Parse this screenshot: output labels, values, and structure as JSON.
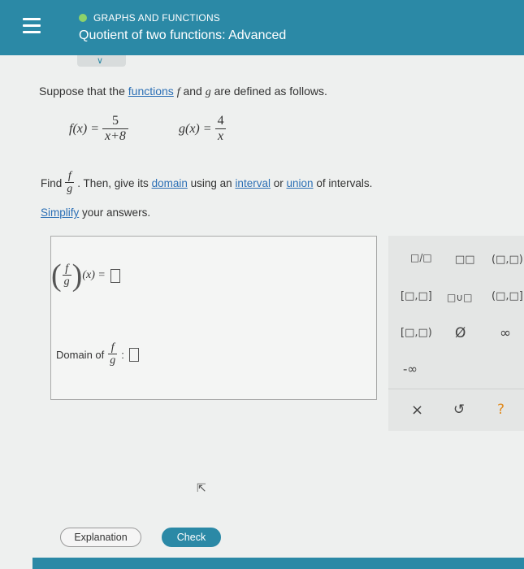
{
  "header": {
    "topic": "GRAPHS AND FUNCTIONS",
    "title": "Quotient of two functions: Advanced",
    "topic_dot_color": "#8dd36a",
    "bg_color": "#2b89a6"
  },
  "question": {
    "intro_prefix": "Suppose that the",
    "intro_link": "functions",
    "intro_f": "f",
    "intro_and": "and",
    "intro_g": "g",
    "intro_suffix": "are defined as follows.",
    "f_lhs": "f(x) =",
    "f_num": "5",
    "f_den": "x+8",
    "g_lhs": "g(x) =",
    "g_num": "4",
    "g_den": "x",
    "find_label": "Find",
    "find_num": "f",
    "find_den": "g",
    "find_text1": ". Then, give its",
    "find_link_domain": "domain",
    "find_text2": "using an",
    "find_link_interval": "interval",
    "find_text3": "or",
    "find_link_union": "union",
    "find_text4": "of intervals.",
    "simplify_link": "Simplify",
    "simplify_rest": "your answers."
  },
  "answer": {
    "lhs_num": "f",
    "lhs_den": "g",
    "lhs_arg": "(x) =",
    "domain_label": "Domain of",
    "domain_num": "f",
    "domain_den": "g",
    "domain_colon": ":"
  },
  "toolbar": {
    "fraction": "□/□",
    "exponent": "□□",
    "open_open": "(□,□)",
    "closed_closed": "[□,□]",
    "union": "□∪□",
    "open_closed": "(□,□]",
    "closed_open": "[□,□)",
    "empty_set": "Ø",
    "infinity": "∞",
    "neg_infinity": "-∞",
    "clear": "×",
    "undo": "↺",
    "help": "?"
  },
  "buttons": {
    "explanation": "Explanation",
    "check": "Check"
  }
}
